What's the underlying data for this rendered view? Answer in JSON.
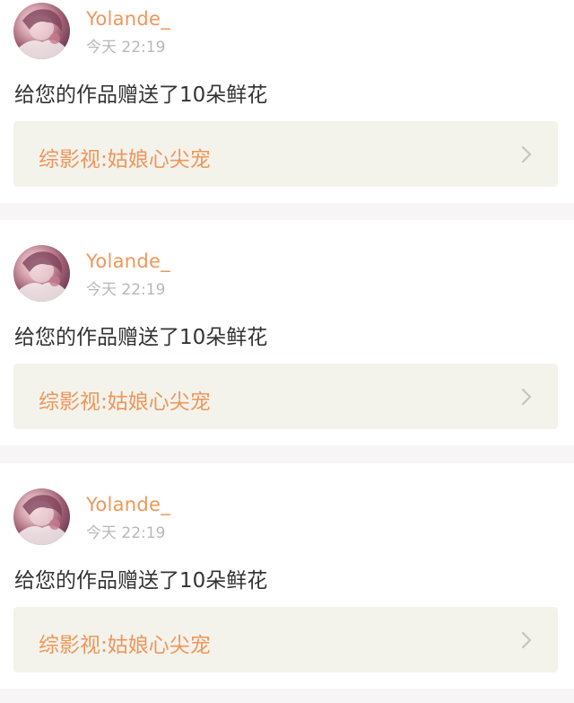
{
  "colors": {
    "accent": "#f0965a",
    "link_bg": "#f3f3ec",
    "separator": "#f7f5f5",
    "message_text": "#333333",
    "time_text": "#b8b8b8"
  },
  "notifications": [
    {
      "username": "Yolande_",
      "time": "今天 22:19",
      "message": "给您的作品赠送了10朵鲜花",
      "work_title": "综影视:姑娘心尖宠",
      "icon": "chevron-right-icon"
    },
    {
      "username": "Yolande_",
      "time": "今天 22:19",
      "message": "给您的作品赠送了10朵鲜花",
      "work_title": "综影视:姑娘心尖宠",
      "icon": "chevron-right-icon"
    },
    {
      "username": "Yolande_",
      "time": "今天 22:19",
      "message": "给您的作品赠送了10朵鲜花",
      "work_title": "综影视:姑娘心尖宠",
      "icon": "chevron-right-icon"
    }
  ]
}
